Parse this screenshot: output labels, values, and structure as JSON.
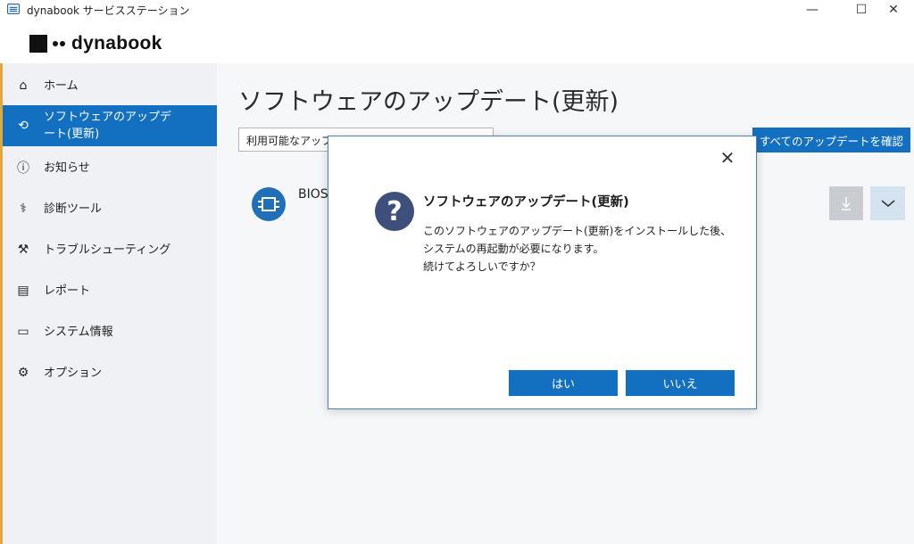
{
  "window": {
    "title": "dynabook サービスステーション",
    "minimize_glyph": "—",
    "maximize_glyph": "☐",
    "close_glyph": "✕"
  },
  "logo": {
    "text": "dynabook"
  },
  "sidebar": {
    "items": [
      {
        "label": "ホーム",
        "icon": "home-icon",
        "glyph": "⌂"
      },
      {
        "label": "ソフトウェアのアップデート(更新)",
        "icon": "refresh-icon",
        "glyph": "⟲",
        "active": true
      },
      {
        "label": "お知らせ",
        "icon": "info-icon",
        "glyph": "ⓘ"
      },
      {
        "label": "診断ツール",
        "icon": "stethoscope-icon",
        "glyph": "⚕"
      },
      {
        "label": "トラブルシューティング",
        "icon": "wrench-icon",
        "glyph": "⚒"
      },
      {
        "label": "レポート",
        "icon": "clipboard-icon",
        "glyph": "▤"
      },
      {
        "label": "システム情報",
        "icon": "laptop-icon",
        "glyph": "▭"
      },
      {
        "label": "オプション",
        "icon": "gear-icon",
        "glyph": "⚙"
      }
    ]
  },
  "main": {
    "title": "ソフトウェアのアップデート(更新)",
    "filter": {
      "value": "利用可能なアップ"
    },
    "check_all_label": "すべてのアップデートを確認",
    "update_item": {
      "name": "BIOS",
      "icon": "chip-icon"
    }
  },
  "dialog": {
    "title": "ソフトウェアのアップデート(更新)",
    "body_lines": [
      "このソフトウェアのアップデート(更新)をインストールした後、",
      "システムの再起動が必要になります。",
      "続けてよろしいですか？"
    ],
    "yes_label": "はい",
    "no_label": "いいえ",
    "icon_glyph": "?",
    "close_glyph": "✕"
  },
  "colors": {
    "accent": "#1370c0",
    "sidebar_bg": "#eff1f4",
    "dialog_icon": "#3e4f7c"
  }
}
